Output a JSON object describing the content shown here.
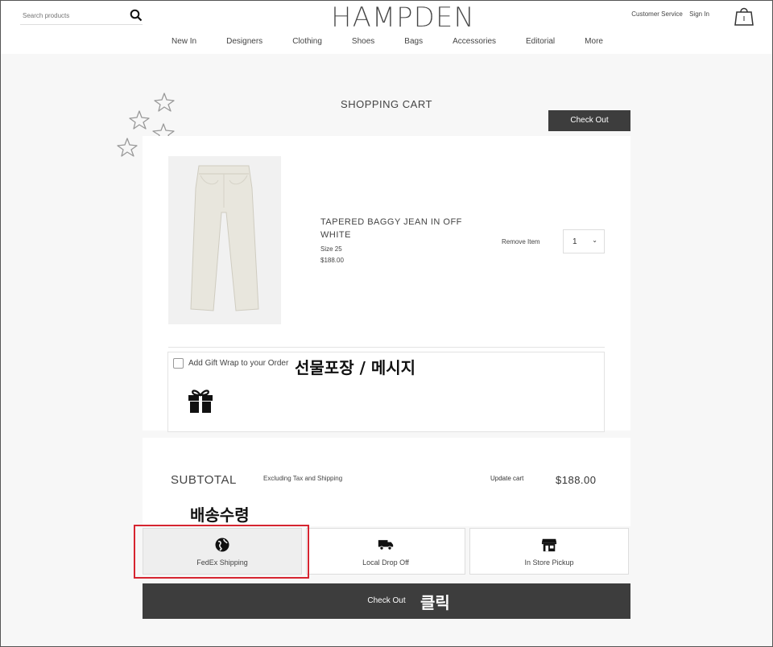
{
  "header": {
    "search_placeholder": "Search products",
    "logo": "HAMPDEN",
    "links": {
      "customer_service": "Customer Service",
      "sign_in": "Sign In"
    },
    "nav": [
      "New In",
      "Designers",
      "Clothing",
      "Shoes",
      "Bags",
      "Accessories",
      "Editorial",
      "More"
    ]
  },
  "cart": {
    "title": "SHOPPING CART",
    "checkout_label": "Check Out",
    "item": {
      "name": "TAPERED BAGGY JEAN IN OFF WHITE",
      "size": "Size 25",
      "price": "$188.00",
      "remove_label": "Remove Item",
      "quantity": "1"
    },
    "gift_wrap_label": "Add Gift Wrap to your Order",
    "subtotal_label": "SUBTOTAL",
    "subtotal_note": "Excluding Tax and Shipping",
    "update_label": "Update cart",
    "subtotal_value": "$188.00",
    "shipping_options": [
      {
        "label": "FedEx Shipping",
        "icon": "globe-icon",
        "selected": true
      },
      {
        "label": "Local Drop Off",
        "icon": "truck-icon",
        "selected": false
      },
      {
        "label": "In Store Pickup",
        "icon": "store-icon",
        "selected": false
      }
    ],
    "checkout_bottom_label": "Check Out"
  },
  "annotations": {
    "gift": "선물포장  /  메시지",
    "shipping": "배송수령",
    "click": "클릭"
  },
  "colors": {
    "dark_button": "#3d3d3d",
    "highlight_border": "#d62530"
  }
}
